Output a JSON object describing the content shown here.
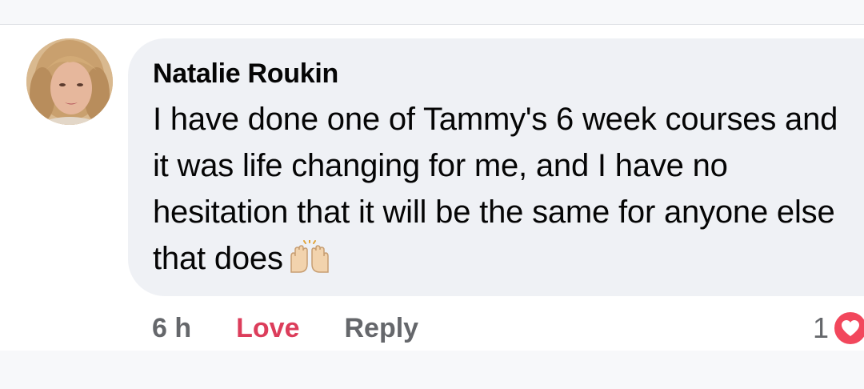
{
  "comment": {
    "author": "Natalie Roukin",
    "text": "I have done one of Tammy's 6 week courses and it was life changing for me, and I have no hesitation that it will be the same for anyone else that does",
    "emoji": "raising-hands-icon"
  },
  "actions": {
    "time": "6 h",
    "love_label": "Love",
    "reply_label": "Reply"
  },
  "reactions": {
    "count": "1",
    "type": "love-heart-icon"
  },
  "colors": {
    "bubble": "#eff1f5",
    "love": "#dc3d5b",
    "muted": "#65676b",
    "heart": "#f2475c"
  }
}
